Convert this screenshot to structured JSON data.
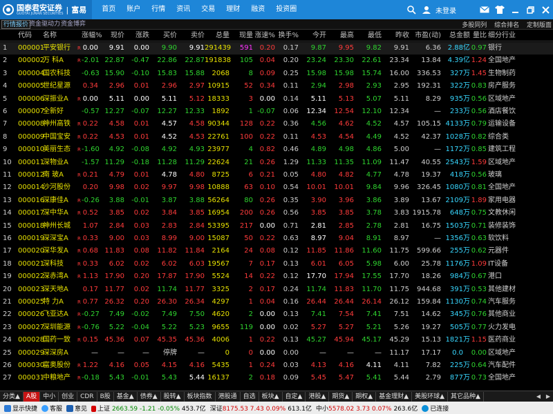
{
  "brand": {
    "name": "国泰君安证券",
    "sub": "GUOTAI JUNAN SECURITIES",
    "sep": "|",
    "product": "富易"
  },
  "menu": [
    "首页",
    "账户",
    "行情",
    "资讯",
    "交易",
    "理财",
    "融资",
    "投资圈"
  ],
  "user": {
    "label": "未登录"
  },
  "icons": [
    "mail-icon",
    "shirt-icon",
    "minimize-icon",
    "restore-icon",
    "close-icon"
  ],
  "subtabs": [
    "行情报价",
    "资金驱动力",
    "资金博弈"
  ],
  "subright": [
    "多股同列",
    "综合排名",
    "定制版面"
  ],
  "columns": [
    "",
    "代码",
    "名称",
    "",
    "涨幅%",
    "现价",
    "涨跌",
    "买价",
    "卖价",
    "总量",
    "现量",
    "涨速%",
    "换手%",
    "今开",
    "最高",
    "最低",
    "昨收",
    "市盈(动)",
    "总金额",
    "量比",
    "细分行业"
  ],
  "rows": [
    [
      "1",
      "000001",
      "平安银行",
      "R",
      "0.00",
      "9.91",
      "0.00",
      "9.90",
      "9.91",
      "291439",
      "591",
      "0.20",
      "0.17",
      "9.87",
      "9.95",
      "9.82",
      "9.91",
      "6.36",
      "2.88",
      "亿",
      "0.97",
      "银行"
    ],
    [
      "2",
      "000002",
      "万 科A",
      "R",
      "-2.01",
      "22.87",
      "-0.47",
      "22.86",
      "22.87",
      "191838",
      "105",
      "0.04",
      "0.20",
      "23.24",
      "23.30",
      "22.61",
      "23.34",
      "13.84",
      "4.39",
      "亿",
      "1.24",
      "全国地产"
    ],
    [
      "3",
      "000004",
      "国农科技",
      "",
      "-0.63",
      "15.90",
      "-0.10",
      "15.83",
      "15.88",
      "2068",
      "8",
      "0.09",
      "0.25",
      "15.98",
      "15.98",
      "15.74",
      "16.00",
      "336.53",
      "327",
      "万",
      "1.45",
      "生物制药"
    ],
    [
      "4",
      "000005",
      "世纪星源",
      "",
      "0.34",
      "2.96",
      "0.01",
      "2.96",
      "2.97",
      "10915",
      "52",
      "0.34",
      "0.11",
      "2.94",
      "2.98",
      "2.93",
      "2.95",
      "192.31",
      "322",
      "万",
      "0.83",
      "房产服务"
    ],
    [
      "5",
      "000006",
      "深振业A",
      "R",
      "0.00",
      "5.11",
      "0.00",
      "5.11",
      "5.12",
      "18333",
      "3",
      "0.00",
      "0.14",
      "5.11",
      "5.13",
      "5.07",
      "5.11",
      "8.29",
      "935",
      "万",
      "0.56",
      "区域地产"
    ],
    [
      "6",
      "000007",
      "全新好",
      "",
      "-0.57",
      "12.27",
      "-0.07",
      "12.27",
      "12.33",
      "1892",
      "1",
      "-0.07",
      "0.06",
      "12.34",
      "12.54",
      "12.10",
      "12.34",
      "—",
      "233",
      "万",
      "0.56",
      "酒店餐饮"
    ],
    [
      "7",
      "000008",
      "神州高铁",
      "R",
      "0.22",
      "4.58",
      "0.01",
      "4.57",
      "4.58",
      "90344",
      "128",
      "0.22",
      "0.36",
      "4.56",
      "4.62",
      "4.52",
      "4.57",
      "105.15",
      "4133",
      "万",
      "0.79",
      "运输设备"
    ],
    [
      "8",
      "000009",
      "中国宝安",
      "R",
      "0.22",
      "4.53",
      "0.01",
      "4.52",
      "4.53",
      "22761",
      "100",
      "0.22",
      "0.11",
      "4.53",
      "4.54",
      "4.49",
      "4.52",
      "42.37",
      "1028",
      "万",
      "0.82",
      "综合类"
    ],
    [
      "9",
      "000010",
      "美丽生态",
      "R",
      "-1.60",
      "4.92",
      "-0.08",
      "4.92",
      "4.93",
      "23977",
      "4",
      "0.82",
      "0.46",
      "4.89",
      "4.98",
      "4.86",
      "5.00",
      "—",
      "1172",
      "万",
      "0.85",
      "建筑工程"
    ],
    [
      "10",
      "000011",
      "深物业A",
      "",
      "-1.57",
      "11.29",
      "-0.18",
      "11.28",
      "11.29",
      "22624",
      "21",
      "0.26",
      "1.29",
      "11.33",
      "11.35",
      "11.09",
      "11.47",
      "40.55",
      "2543",
      "万",
      "1.59",
      "区域地产"
    ],
    [
      "11",
      "000012",
      "南 玻A",
      "R",
      "0.21",
      "4.79",
      "0.01",
      "4.78",
      "4.80",
      "8725",
      "6",
      "0.21",
      "0.05",
      "4.80",
      "4.82",
      "4.77",
      "4.78",
      "19.37",
      "418",
      "万",
      "0.56",
      "玻璃"
    ],
    [
      "12",
      "000014",
      "沙河股份",
      "",
      "0.20",
      "9.98",
      "0.02",
      "9.97",
      "9.98",
      "10888",
      "63",
      "0.10",
      "0.54",
      "10.01",
      "10.01",
      "9.84",
      "9.96",
      "326.45",
      "1080",
      "万",
      "0.81",
      "全国地产"
    ],
    [
      "13",
      "000016",
      "深康佳A",
      "R",
      "-0.26",
      "3.88",
      "-0.01",
      "3.87",
      "3.88",
      "56264",
      "80",
      "0.26",
      "0.35",
      "3.90",
      "3.96",
      "3.86",
      "3.89",
      "13.67",
      "2109",
      "万",
      "1.89",
      "家用电器"
    ],
    [
      "14",
      "000017",
      "深中华A",
      "R",
      "0.52",
      "3.85",
      "0.02",
      "3.84",
      "3.85",
      "16954",
      "200",
      "0.26",
      "0.56",
      "3.85",
      "3.85",
      "3.78",
      "3.83",
      "1915.78",
      "648",
      "万",
      "0.75",
      "文教休闲"
    ],
    [
      "15",
      "000018",
      "神州长城",
      "",
      "1.07",
      "2.84",
      "0.03",
      "2.83",
      "2.84",
      "53395",
      "217",
      "0.00",
      "0.71",
      "2.81",
      "2.85",
      "2.78",
      "2.81",
      "16.75",
      "1503",
      "万",
      "0.71",
      "装修装饰"
    ],
    [
      "16",
      "000019",
      "深深宝A",
      "R",
      "0.33",
      "9.00",
      "0.03",
      "8.99",
      "9.00",
      "15087",
      "50",
      "0.22",
      "0.63",
      "8.97",
      "9.04",
      "8.91",
      "8.97",
      "—",
      "1356",
      "万",
      "0.63",
      "软饮料"
    ],
    [
      "17",
      "000020",
      "深华发A",
      "R",
      "0.68",
      "11.83",
      "0.08",
      "11.82",
      "11.84",
      "2164",
      "24",
      "0.08",
      "0.12",
      "11.85",
      "11.86",
      "11.60",
      "11.75",
      "599.66",
      "255",
      "万",
      "0.62",
      "元器件"
    ],
    [
      "18",
      "000021",
      "深科技",
      "R",
      "0.33",
      "6.02",
      "0.02",
      "6.02",
      "6.03",
      "19567",
      "7",
      "0.17",
      "0.13",
      "6.01",
      "6.05",
      "5.98",
      "6.00",
      "25.78",
      "1176",
      "万",
      "1.09",
      "IT设备"
    ],
    [
      "19",
      "000022",
      "深赤湾A",
      "R",
      "1.13",
      "17.90",
      "0.20",
      "17.87",
      "17.90",
      "5524",
      "14",
      "0.22",
      "0.12",
      "17.70",
      "17.94",
      "17.55",
      "17.70",
      "18.26",
      "984",
      "万",
      "0.67",
      "港口"
    ],
    [
      "20",
      "000023",
      "深天地A",
      "",
      "0.17",
      "11.77",
      "0.02",
      "11.74",
      "11.77",
      "3325",
      "2",
      "0.17",
      "0.24",
      "11.74",
      "11.83",
      "11.70",
      "11.75",
      "944.68",
      "391",
      "万",
      "0.53",
      "其他建材"
    ],
    [
      "21",
      "000025",
      "特 力A",
      "R",
      "0.77",
      "26.32",
      "0.20",
      "26.30",
      "26.34",
      "4297",
      "1",
      "0.04",
      "0.16",
      "26.44",
      "26.44",
      "26.14",
      "26.12",
      "159.84",
      "1130",
      "万",
      "0.74",
      "汽车服务"
    ],
    [
      "22",
      "000026",
      "飞亚达A",
      "R",
      "-0.27",
      "7.49",
      "-0.02",
      "7.49",
      "7.50",
      "4620",
      "2",
      "0.00",
      "0.13",
      "7.41",
      "7.54",
      "7.41",
      "7.51",
      "14.62",
      "345",
      "万",
      "0.76",
      "其他商业"
    ],
    [
      "23",
      "000027",
      "深圳能源",
      "R",
      "-0.76",
      "5.22",
      "-0.04",
      "5.22",
      "5.23",
      "9655",
      "119",
      "0.00",
      "0.02",
      "5.27",
      "5.27",
      "5.21",
      "5.26",
      "19.27",
      "505",
      "万",
      "0.77",
      "火力发电"
    ],
    [
      "24",
      "000028",
      "国药一致",
      "R",
      "0.15",
      "45.36",
      "0.07",
      "45.35",
      "45.36",
      "4006",
      "1",
      "0.22",
      "0.13",
      "45.27",
      "45.94",
      "45.17",
      "45.29",
      "15.13",
      "1821",
      "万",
      "1.15",
      "医药商业"
    ],
    [
      "25",
      "000029",
      "深深房A",
      "",
      "—",
      "—",
      "—",
      "停牌",
      "—",
      "0",
      "0",
      "0.00",
      "0.00",
      "—",
      "—",
      "—",
      "11.17",
      "17.17",
      "0.0",
      "",
      "0.00",
      "区域地产"
    ],
    [
      "26",
      "000030",
      "富奥股份",
      "R",
      "1.22",
      "4.16",
      "0.05",
      "4.15",
      "4.16",
      "5435",
      "1",
      "0.24",
      "0.03",
      "4.13",
      "4.16",
      "4.11",
      "4.11",
      "7.82",
      "225",
      "万",
      "0.64",
      "汽车配件"
    ],
    [
      "27",
      "000031",
      "中粮地产",
      "R",
      "-0.18",
      "5.43",
      "-0.01",
      "5.43",
      "5.44",
      "16137",
      "2",
      "0.18",
      "0.09",
      "5.45",
      "5.47",
      "5.41",
      "5.44",
      "2.79",
      "877",
      "万",
      "0.73",
      "全国地产"
    ]
  ],
  "bottom_tabs": [
    "分类▲",
    "A股",
    "中小",
    "创业",
    "CDR",
    "B股",
    "基金▲",
    "债券▲",
    "股转▲",
    "板块指数",
    "港股通",
    "自选",
    "板块▲",
    "自定▲",
    "港股▲",
    "期货▲",
    "期权▲",
    "基金理财▲",
    "美股环球▲",
    "其它品种▲"
  ],
  "status": {
    "quick_trade": "显示快捷",
    "service": "客服",
    "feedback": "意见",
    "sh_label": "上证",
    "sh_index": "2663.59",
    "sh_change": "-1.21",
    "sh_pct": "-0.05%",
    "sh_amount": "453.7亿",
    "sz_label": "深证",
    "sz_index": "8175.53",
    "sz_change": "7.43",
    "sz_pct": "0.09%",
    "sz_amount": "613.1亿",
    "zx_label": "中小",
    "zx_index": "5578.02",
    "zx_change": "3.73",
    "zx_pct": "0.07%",
    "zx_amount": "263.6亿",
    "conn": "已连接"
  }
}
